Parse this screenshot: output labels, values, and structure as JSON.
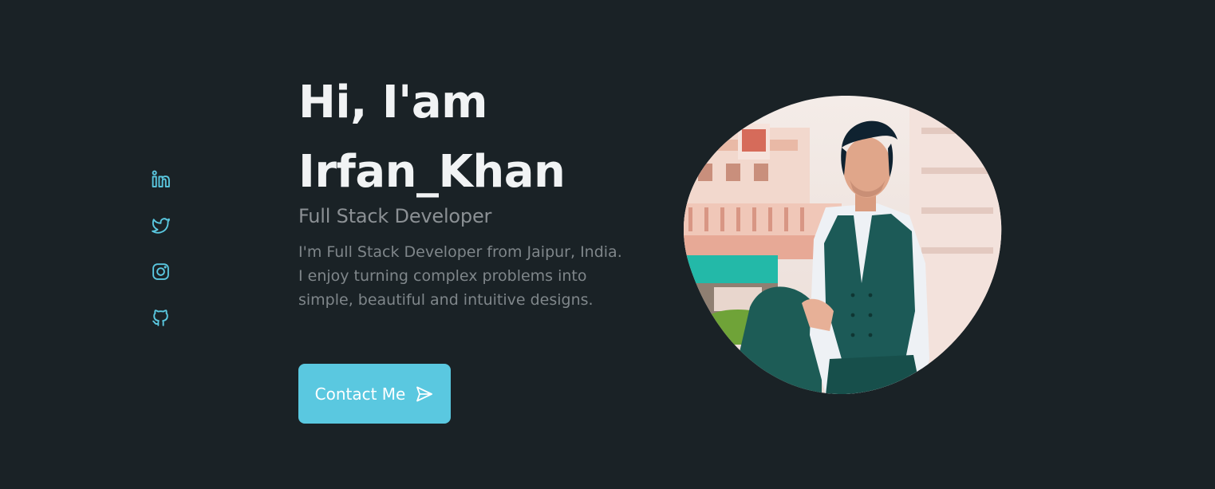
{
  "hero": {
    "greeting": "Hi, I'am",
    "name": "Irfan_Khan",
    "role": "Full Stack Developer",
    "description": [
      "I'm Full Stack Developer from Jaipur, India.",
      "I enjoy turning complex problems into",
      "simple, beautiful and intuitive designs."
    ],
    "contact_label": "Contact Me",
    "contact_icon": "send-icon"
  },
  "social": [
    {
      "name": "linkedin",
      "icon": "linkedin-icon"
    },
    {
      "name": "twitter",
      "icon": "twitter-icon"
    },
    {
      "name": "instagram",
      "icon": "instagram-icon"
    },
    {
      "name": "github",
      "icon": "github-icon"
    }
  ],
  "colors": {
    "background": "#1a2226",
    "accent": "#5ac8e0",
    "heading": "#f1f3f4",
    "subtitle": "#8b9094",
    "body_text": "#7f868a"
  }
}
